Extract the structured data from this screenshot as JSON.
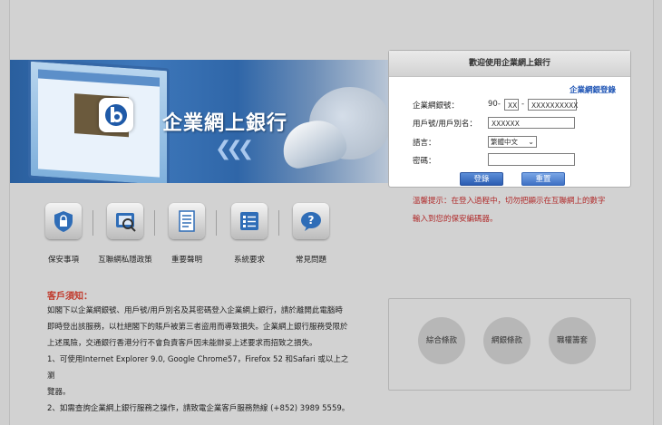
{
  "banner": {
    "title": "企業網上銀行"
  },
  "login": {
    "header": "歡迎使用企業網上銀行",
    "link": "企業網銀登錄",
    "account_label": "企業網銀號：",
    "account_prefix": "90-",
    "account_part1": "XX",
    "account_dash": "-",
    "account_part2": "XXXXXXXXXX",
    "user_label": "用戶號/用戶別名：",
    "user_value": "XXXXXX",
    "lang_label": "語言：",
    "lang_value": "繁體中文",
    "password_label": "密碼：",
    "login_button": "登錄",
    "reset_button": "重置"
  },
  "warning": {
    "line1": "溫馨提示：在登入過程中，切勿把顯示在互聯網上的數字",
    "line2": "輸入到您的保安編碼器。"
  },
  "quick_icons": [
    {
      "label": "保安事項",
      "icon": "shield-icon"
    },
    {
      "label": "互聯網私隱政策",
      "icon": "privacy-icon"
    },
    {
      "label": "重要聲明",
      "icon": "document-icon"
    },
    {
      "label": "系統要求",
      "icon": "checklist-icon"
    },
    {
      "label": "常見問題",
      "icon": "question-icon"
    }
  ],
  "notice": {
    "title": "客戶須知：",
    "p1": "如閣下以企業網銀號、用戶號/用戶別名及其密碼登入企業網上銀行，請於離開此電腦時",
    "p2": "即時登出該服務，以杜絕閣下的賬戶被第三者盜用而導致損失。企業網上銀行服務受限於",
    "p3": "上述風險，交通銀行香港分行不會負責客戶因未能辦妥上述要求而招致之損失。",
    "p4": "1、可使用Internet Explorer 9.0, Google Chrome57，Firefox 52 和Safari 或以上之瀏",
    "p5": "覽器。",
    "p6": "2、如需查詢企業網上銀行服務之操作，請致電企業客戶服務熱線 (+852) 3989 5559。"
  },
  "quick_links": [
    {
      "label": "綜合條款"
    },
    {
      "label": "網銀條款"
    },
    {
      "label": "職權籌套"
    }
  ]
}
